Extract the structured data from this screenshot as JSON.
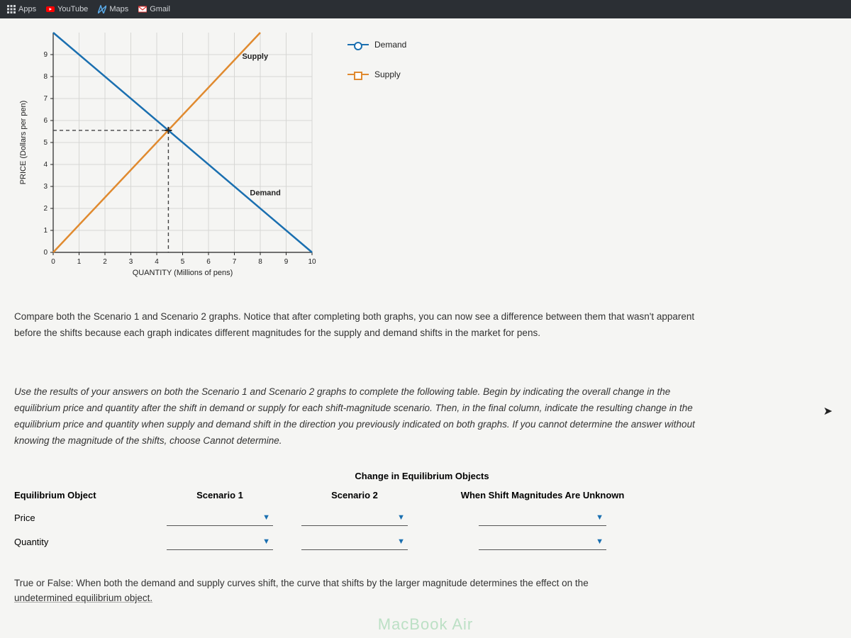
{
  "bookmarks": {
    "apps": "Apps",
    "youtube": "YouTube",
    "maps": "Maps",
    "gmail": "Gmail"
  },
  "chart_data": {
    "type": "line",
    "xlabel": "QUANTITY (Millions of pens)",
    "ylabel": "PRICE (Dollars per pen)",
    "xlim": [
      0,
      10
    ],
    "ylim": [
      0,
      10
    ],
    "x_ticks": [
      0,
      1,
      2,
      3,
      4,
      5,
      6,
      7,
      8,
      9,
      10
    ],
    "y_ticks": [
      0,
      1,
      2,
      3,
      4,
      5,
      6,
      7,
      8,
      9
    ],
    "series": [
      {
        "name": "Demand",
        "color": "#1a6fb0",
        "points": [
          [
            0,
            10
          ],
          [
            10,
            0
          ]
        ]
      },
      {
        "name": "Supply",
        "color": "#e08a2f",
        "points": [
          [
            0,
            0
          ],
          [
            8,
            10
          ]
        ]
      }
    ],
    "annotations": [
      {
        "text": "Supply",
        "x": 7.3,
        "y": 8.8
      },
      {
        "text": "Demand",
        "x": 7.6,
        "y": 2.6
      }
    ],
    "equilibrium_dashed": {
      "x": 4.45,
      "y": 5.55
    }
  },
  "legend": {
    "demand": "Demand",
    "supply": "Supply"
  },
  "para1": "Compare both the Scenario 1 and Scenario 2 graphs. Notice that after completing both graphs, you can now see a difference between them that wasn't apparent before the shifts because each graph indicates different magnitudes for the supply and demand shifts in the market for pens.",
  "para2": "Use the results of your answers on both the Scenario 1 and Scenario 2 graphs to complete the following table. Begin by indicating the overall change in the equilibrium price and quantity after the shift in demand or supply for each shift-magnitude scenario. Then, in the final column, indicate the resulting change in the equilibrium price and quantity when supply and demand shift in the direction you previously indicated on both graphs. If you cannot determine the answer without knowing the magnitude of the shifts, choose Cannot determine.",
  "table": {
    "super_header": "Change in Equilibrium Objects",
    "headers": {
      "obj": "Equilibrium Object",
      "s1": "Scenario 1",
      "s2": "Scenario 2",
      "unk": "When Shift Magnitudes Are Unknown"
    },
    "rows": [
      {
        "label": "Price"
      },
      {
        "label": "Quantity"
      }
    ]
  },
  "tf_line1": "True or False: When both the demand and supply curves shift, the curve that shifts by the larger magnitude determines the effect on the",
  "tf_line2": "undetermined equilibrium object.",
  "watermark": "MacBook Air"
}
